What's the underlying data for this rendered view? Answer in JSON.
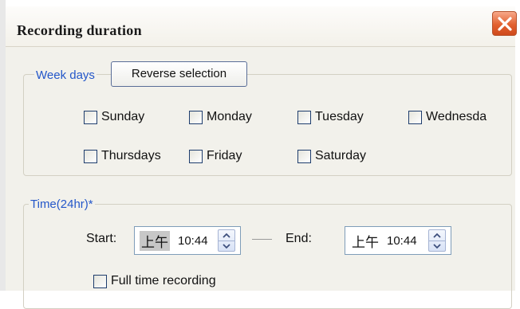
{
  "dialog": {
    "title": "Recording duration"
  },
  "week_days": {
    "legend": "Week days",
    "reverse_button": "Reverse selection",
    "days": [
      {
        "label": "Sunday",
        "checked": false
      },
      {
        "label": "Monday",
        "checked": false
      },
      {
        "label": "Tuesday",
        "checked": false
      },
      {
        "label": "Wednesda",
        "checked": false
      },
      {
        "label": "Thursdays",
        "checked": false
      },
      {
        "label": "Friday",
        "checked": false
      },
      {
        "label": "Saturday",
        "checked": false
      }
    ]
  },
  "time": {
    "legend": "Time(24hr)*",
    "start_label": "Start:",
    "start_ampm": "上午",
    "start_value": "10:44",
    "end_label": "End:",
    "end_ampm": "上午",
    "end_value": "10:44",
    "full_time_label": "Full time recording",
    "full_time_checked": false
  },
  "colors": {
    "legend_text": "#2457c9",
    "close_button": "#e2612f",
    "dialog_bg": "#f2f1eb"
  }
}
